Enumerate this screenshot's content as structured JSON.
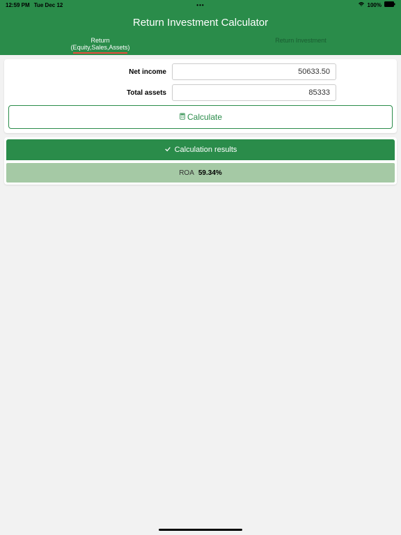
{
  "status": {
    "time": "12:59 PM",
    "date": "Tue Dec 12",
    "dots": "•••",
    "battery": "100%"
  },
  "header": {
    "title": "Return Investment Calculator",
    "tabs": [
      {
        "line1": "Return",
        "line2": "(Equity,Sales,Assets)"
      },
      {
        "line1": "Return Investment",
        "line2": ""
      }
    ]
  },
  "form": {
    "net_income_label": "Net income",
    "net_income_value": "50633.50",
    "total_assets_label": "Total assets",
    "total_assets_value": "85333",
    "calculate_btn": "Calculate"
  },
  "results": {
    "heading": "Calculation results",
    "roa_label": "ROA",
    "roa_value": "59.34%"
  }
}
